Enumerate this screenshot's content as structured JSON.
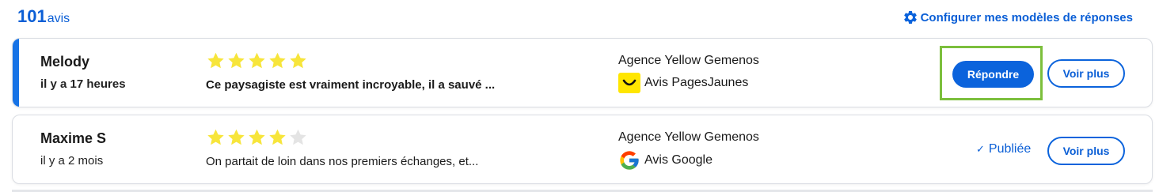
{
  "header": {
    "review_count": "101",
    "review_unit": "avis",
    "config_link_label": "Configurer mes modèles de réponses",
    "config_icon": "gear-icon"
  },
  "colors": {
    "accent": "#0b63dc",
    "star_filled": "#f7e53b",
    "star_empty": "#e4e4e4",
    "highlight": "#7cbf3c",
    "pagesjaunes_yellow": "#ffe600"
  },
  "reviews": [
    {
      "author": "Melody",
      "time": "il y a 17 heures",
      "rating": 5,
      "max_rating": 5,
      "comment": "Ce paysagiste est vraiment incroyable, il a sauvé ...",
      "agency": "Agence Yellow Gemenos",
      "source": "Avis PagesJaunes",
      "source_icon": "pagesjaunes-logo-icon",
      "unread": true,
      "reply_label": "Répondre",
      "more_label": "Voir plus"
    },
    {
      "author": "Maxime S",
      "time": "il y a 2 mois",
      "rating": 4,
      "max_rating": 5,
      "comment": "On partait de loin dans nos premiers échanges, et...",
      "agency": "Agence Yellow Gemenos",
      "source": "Avis Google",
      "source_icon": "google-logo-icon",
      "status": "Publiée",
      "status_icon": "checkmark-icon",
      "more_label": "Voir plus"
    }
  ]
}
